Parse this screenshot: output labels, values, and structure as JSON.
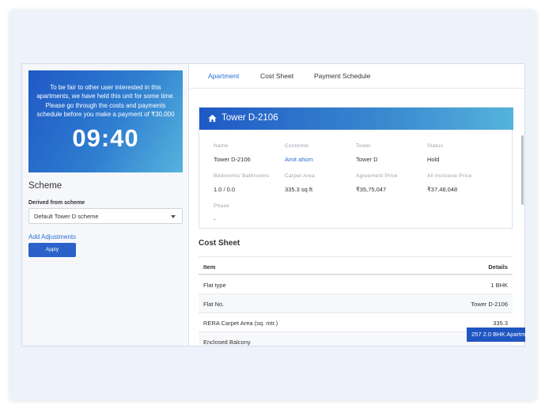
{
  "hold": {
    "message": "To be fair to other user interested in this apartments, we have held this unit for some time. Please go through the costs and payments schedule before you make a payment of ₹30,000",
    "timer": "09:40"
  },
  "scheme": {
    "title": "Scheme",
    "derived_label": "Derived from scheme",
    "selected": "Default Tower D scheme",
    "add_adjustments": "Add Adjustments",
    "apply_label": "Apply"
  },
  "tabs": [
    {
      "label": "Apartment",
      "active": true
    },
    {
      "label": "Cost Sheet",
      "active": false
    },
    {
      "label": "Payment Schedule",
      "active": false
    }
  ],
  "unit": {
    "title": "Tower D-2106",
    "fields": [
      {
        "label": "Name",
        "value": "Tower D-2106"
      },
      {
        "label": "Customer",
        "value": "Amit ahom"
      },
      {
        "label": "Tower",
        "value": "Tower D"
      },
      {
        "label": "Status",
        "value": "Hold"
      },
      {
        "label": "Bedrooms/ Bathrooms",
        "value": "1.0 / 0.0"
      },
      {
        "label": "Carpet Area",
        "value": "335.3 sq ft"
      },
      {
        "label": "Agreement Price",
        "value": "₹35,75,047"
      },
      {
        "label": "All Inclusive Price",
        "value": "₹37,48,048"
      },
      {
        "label": "Phase",
        "value": "-"
      }
    ]
  },
  "cost_sheet": {
    "title": "Cost Sheet",
    "headers": {
      "item": "Item",
      "details": "Details"
    },
    "rows": [
      {
        "item": "Flat type",
        "details": "1 BHK"
      },
      {
        "item": "Flat No.",
        "details": "Tower D-2106"
      },
      {
        "item": "RERA Carpet Area (sq. mtr.)",
        "details": "335.3"
      },
      {
        "item": "Enclosed Balcony",
        "details": ""
      }
    ]
  },
  "floating_tag": "257 2.0 BHK Apartment",
  "colors": {
    "accent": "#2d6fd6",
    "header_gradient_start": "#1f59c5",
    "header_gradient_end": "#55b3dc"
  }
}
